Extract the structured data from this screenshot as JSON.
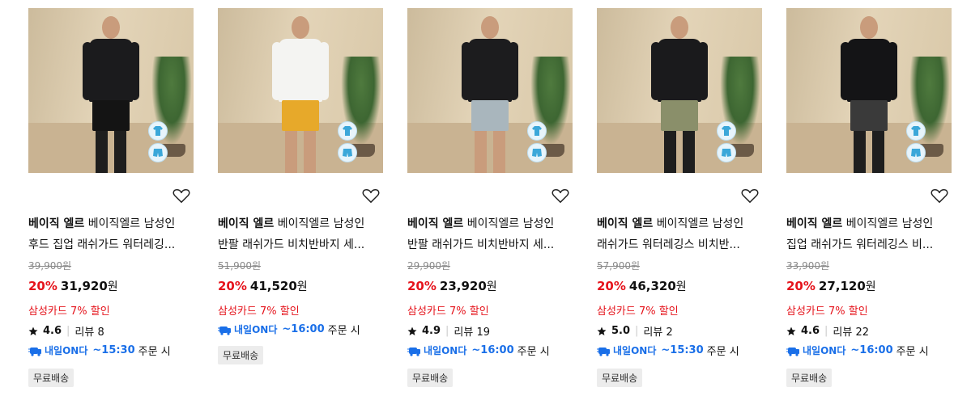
{
  "products": [
    {
      "brand": "베이직 엘르",
      "line1": "베이직엘르 남성인",
      "line2": "후드 집업 래쉬가드 워터레깅...",
      "original_price": "39,900원",
      "discount": "20%",
      "price": "31,920",
      "won": "원",
      "card_discount": "삼성카드 7% 할인",
      "rating": "4.6",
      "review": "리뷰 8",
      "delivery_tag": "내일ON다",
      "delivery_time": "~15:30",
      "delivery_suffix": "주문 시",
      "shipping": "무료배송",
      "colors": {
        "top": "#1b1b1d",
        "shorts": "#141414",
        "legs": "#1e1e1e"
      }
    },
    {
      "brand": "베이직 엘르",
      "line1": "베이직엘르 남성인",
      "line2": "반팔 래쉬가드 비치반바지 세...",
      "original_price": "51,900원",
      "discount": "20%",
      "price": "41,520",
      "won": "원",
      "card_discount": "삼성카드 7% 할인",
      "delivery_tag": "내일ON다",
      "delivery_time": "~16:00",
      "delivery_suffix": "주문 시",
      "shipping": "무료배송",
      "colors": {
        "top": "#f4f4f2",
        "shorts": "#e7a92a",
        "legs": "#c99c7c"
      }
    },
    {
      "brand": "베이직 엘르",
      "line1": "베이직엘르 남성인",
      "line2": "반팔 래쉬가드 비치반바지 세...",
      "original_price": "29,900원",
      "discount": "20%",
      "price": "23,920",
      "won": "원",
      "card_discount": "삼성카드 7% 할인",
      "rating": "4.9",
      "review": "리뷰 19",
      "delivery_tag": "내일ON다",
      "delivery_time": "~16:00",
      "delivery_suffix": "주문 시",
      "shipping": "무료배송",
      "colors": {
        "top": "#1c1c1e",
        "shorts": "#a9b6bd",
        "legs": "#c99c7c"
      }
    },
    {
      "brand": "베이직 엘르",
      "line1": "베이직엘르 남성인",
      "line2": "래쉬가드 워터레깅스 비치반...",
      "original_price": "57,900원",
      "discount": "20%",
      "price": "46,320",
      "won": "원",
      "card_discount": "삼성카드 7% 할인",
      "rating": "5.0",
      "review": "리뷰 2",
      "delivery_tag": "내일ON다",
      "delivery_time": "~15:30",
      "delivery_suffix": "주문 시",
      "shipping": "무료배송",
      "colors": {
        "top": "#1a1a1c",
        "shorts": "#8a8f6a",
        "legs": "#1e1e1e"
      }
    },
    {
      "brand": "베이직 엘르",
      "line1": "베이직엘르 남성인",
      "line2": "집업 래쉬가드 워터레깅스 비...",
      "original_price": "33,900원",
      "discount": "20%",
      "price": "27,120",
      "won": "원",
      "card_discount": "삼성카드 7% 할인",
      "rating": "4.6",
      "review": "리뷰 22",
      "delivery_tag": "내일ON다",
      "delivery_time": "~16:00",
      "delivery_suffix": "주문 시",
      "shipping": "무료배송",
      "colors": {
        "top": "#141416",
        "shorts": "#3a3a3a",
        "legs": "#1e1e1e"
      }
    }
  ],
  "icons": {
    "heart": "heart-outline-icon",
    "star": "star-icon",
    "truck": "delivery-truck-icon",
    "top_badge": "rashguard-top-icon",
    "bottom_badge": "swim-shorts-icon"
  }
}
